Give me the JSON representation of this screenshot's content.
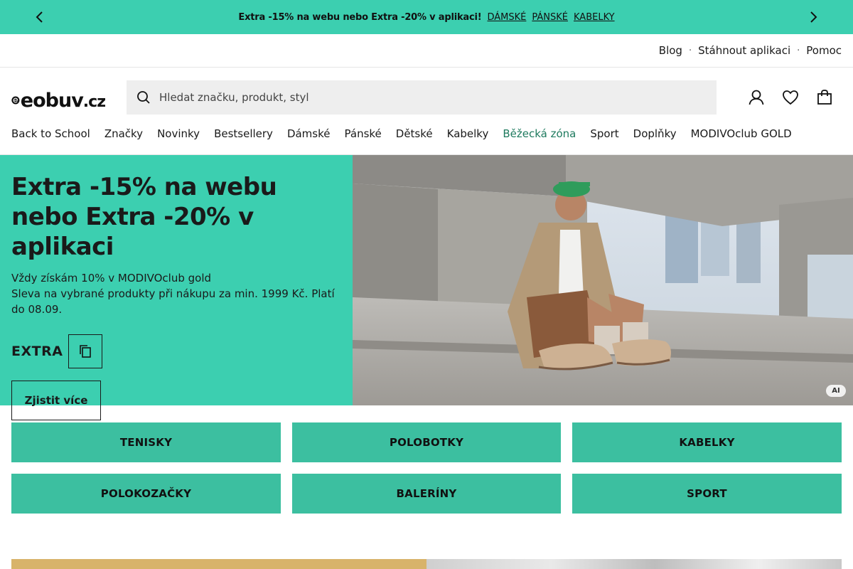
{
  "promo": {
    "text": "Extra -15% na webu nebo Extra -20% v aplikaci!",
    "links": [
      "DÁMSKÉ",
      "PÁNSKÉ",
      "KABELKY"
    ],
    "prev_icon": "chevron-left-icon",
    "next_icon": "chevron-right-icon"
  },
  "utility": {
    "links": [
      "Blog",
      "Stáhnout aplikaci",
      "Pomoc"
    ],
    "separator": "·"
  },
  "header": {
    "logo_text": "eobuv",
    "logo_suffix": ".cz",
    "search_placeholder": "Hledat značku, produkt, styl",
    "icons": [
      "search-icon",
      "user-icon",
      "heart-icon",
      "bag-icon"
    ]
  },
  "nav": {
    "items": [
      "Back to School",
      "Značky",
      "Novinky",
      "Bestsellery",
      "Dámské",
      "Pánské",
      "Dětské",
      "Kabelky",
      "Běžecká zóna",
      "Sport",
      "Doplňky",
      "MODIVOclub GOLD"
    ]
  },
  "hero": {
    "title": "Extra -15% na webu nebo Extra -20% v aplikaci",
    "line1": "Vždy získám 10% v MODIVOclub gold",
    "line2": "Sleva na vybrané produkty při nákupu za min. 1999 Kč. Platí do 08.09.",
    "code_label": "EXTRA",
    "cta": "Zjistit více",
    "ai_badge": "AI",
    "colors": {
      "panel": "#3ccfb0"
    }
  },
  "tiles": [
    "TENISKY",
    "POLOBOTKY",
    "KABELKY",
    "POLOKOZAČKY",
    "BALERÍNY",
    "SPORT"
  ]
}
